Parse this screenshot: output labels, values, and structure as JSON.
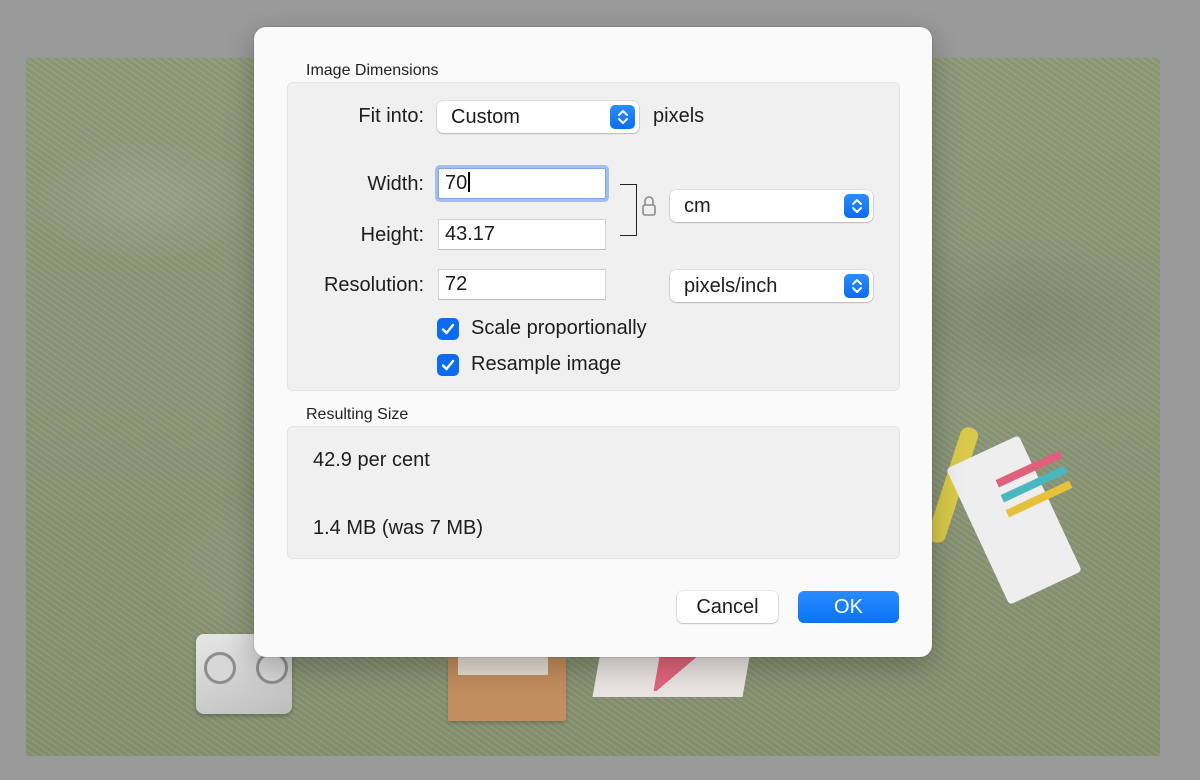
{
  "dialog": {
    "image_dimensions_title": "Image Dimensions",
    "fit_into": {
      "label": "Fit into:",
      "value": "Custom",
      "unit": "pixels"
    },
    "width": {
      "label": "Width:",
      "value": "70"
    },
    "height": {
      "label": "Height:",
      "value": "43.17"
    },
    "units_popup": {
      "value": "cm"
    },
    "resolution": {
      "label": "Resolution:",
      "value": "72"
    },
    "resolution_units_popup": {
      "value": "pixels/inch"
    },
    "scale_proportionally": {
      "label": "Scale proportionally",
      "checked": true
    },
    "resample_image": {
      "label": "Resample image",
      "checked": true
    },
    "resulting_size_title": "Resulting Size",
    "resulting_percent": "42.9 per cent",
    "resulting_bytes": "1.4 MB (was 7 MB)",
    "cancel_label": "Cancel",
    "ok_label": "OK"
  },
  "colors": {
    "accent": "#0a6cf0",
    "dialog_bg": "#fafafa",
    "group_bg": "#f0f0f0",
    "overlay": "#9a9a9a"
  },
  "icons": {
    "popup_stepper": "chevron-up-down-icon",
    "lock": "lock-icon",
    "checkbox": "checkmark-icon"
  }
}
